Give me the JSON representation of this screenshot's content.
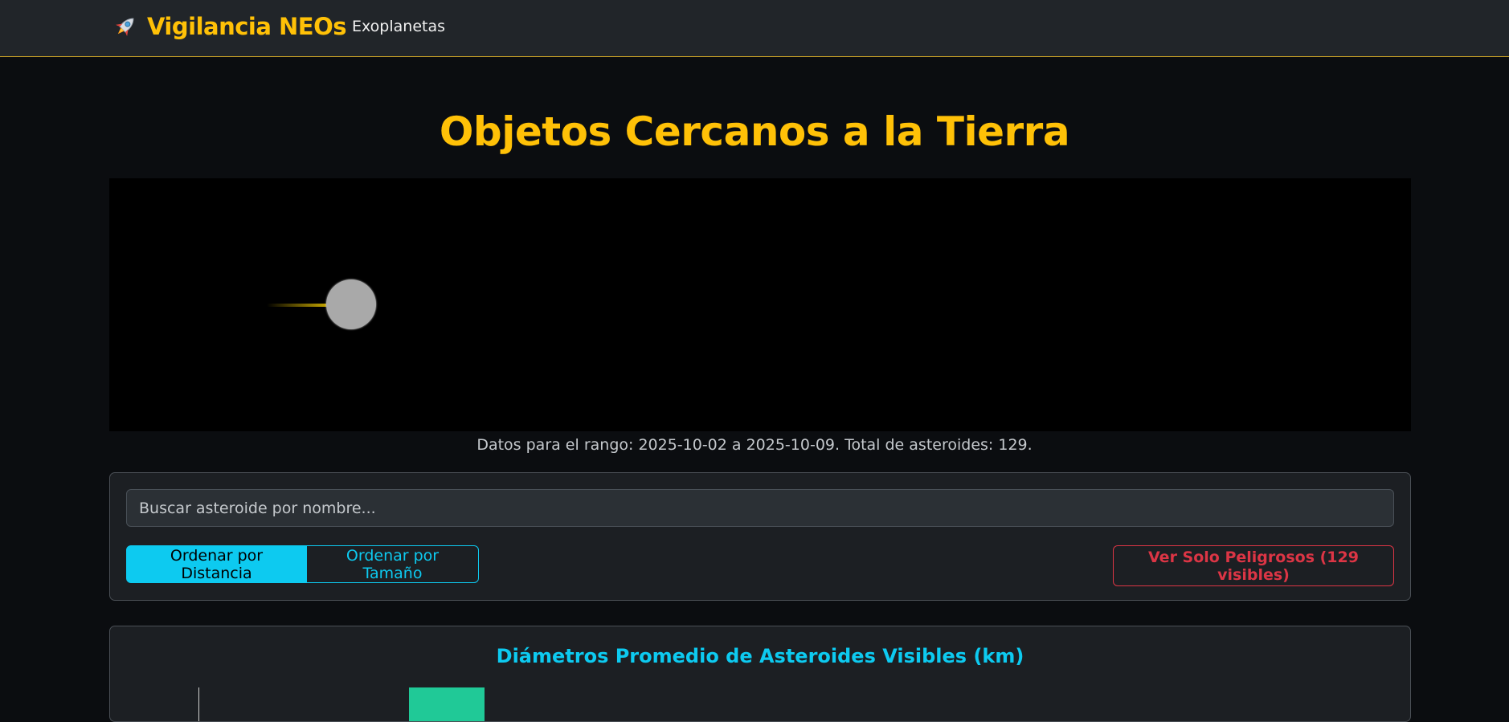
{
  "navbar": {
    "brand_icon": "rocket-icon",
    "brand_text": "Vigilancia NEOs",
    "links": [
      {
        "label": "Exoplanetas"
      }
    ]
  },
  "main": {
    "title": "Objetos Cercanos a la Tierra",
    "range_text": "Datos para el rango: 2025-10-02 a 2025-10-09. Total de asteroides: 129."
  },
  "controls": {
    "search": {
      "value": "",
      "placeholder": "Buscar asteroide por nombre..."
    },
    "sort": {
      "distance_label": "Ordenar por Distancia",
      "size_label": "Ordenar por Tamaño",
      "active": "distance"
    },
    "danger_filter_label": "Ver Solo Peligrosos (129 visibles)"
  },
  "chart": {
    "title": "Diámetros Promedio de Asteroides Visibles (km)"
  },
  "colors": {
    "accent": "#ffc107",
    "info": "#0dcaf0",
    "danger": "#dc3545",
    "bar": "#20c997"
  }
}
